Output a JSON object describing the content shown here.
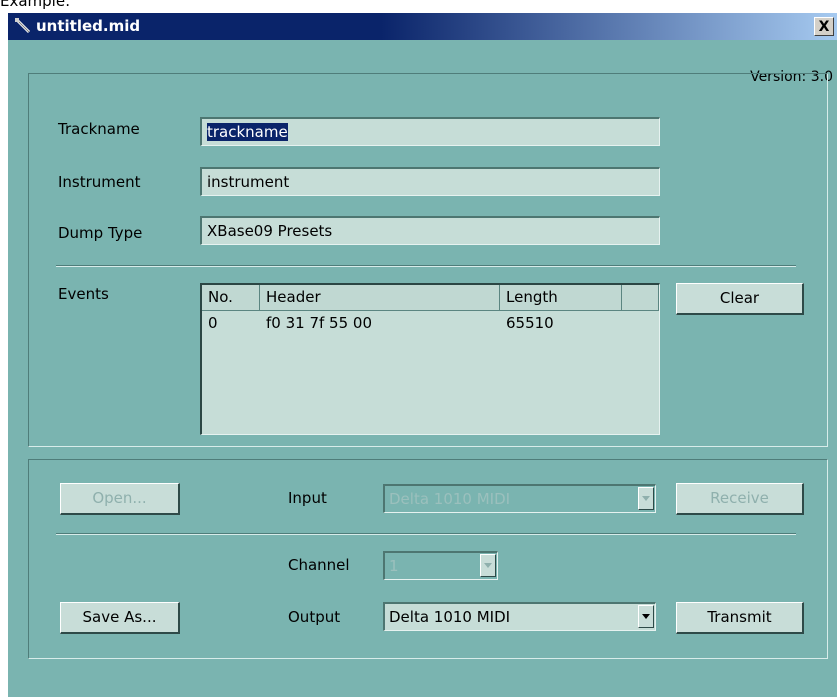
{
  "caption": "Example:",
  "window": {
    "title": "untitled.mid",
    "close_label": "X",
    "version": "Version: 3.0"
  },
  "form": {
    "trackname": {
      "label": "Trackname",
      "value": "trackname"
    },
    "instrument": {
      "label": "Instrument",
      "value": "instrument"
    },
    "dump_type": {
      "label": "Dump Type",
      "value": "XBase09 Presets"
    },
    "events_label": "Events",
    "events": {
      "columns": [
        "No.",
        "Header",
        "Length"
      ],
      "rows": [
        {
          "no": "0",
          "header": "f0 31 7f 55 00",
          "length": "65510"
        }
      ]
    },
    "clear_button": "Clear"
  },
  "io": {
    "open_button": "Open...",
    "input_label": "Input",
    "input_value": "Delta 1010 MIDI",
    "receive_button": "Receive",
    "channel_label": "Channel",
    "channel_value": "1",
    "save_as_button": "Save As...",
    "output_label": "Output",
    "output_value": "Delta 1010 MIDI",
    "transmit_button": "Transmit"
  },
  "colors": {
    "window_bg": "#7ab4b0",
    "title_bar": "#0a246a",
    "selection": "#0a246a"
  },
  "icons": {
    "title": "midi-file-icon",
    "dropdown": "chevron-down-icon"
  }
}
